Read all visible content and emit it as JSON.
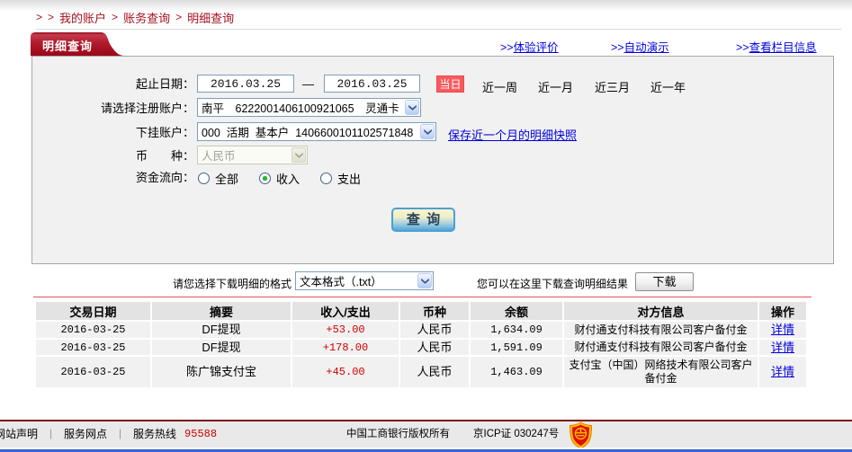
{
  "breadcrumb": {
    "prefix1": ">",
    "prefix2": ">",
    "sep": ">",
    "items": [
      "我的账户",
      "账务查询",
      "明细查询"
    ]
  },
  "tab": {
    "label": "明细查询"
  },
  "toolbar_links": [
    {
      "prefix": ">>",
      "label": "体验评价"
    },
    {
      "prefix": ">>",
      "label": "自动演示"
    },
    {
      "prefix": ">>",
      "label": "查看栏目信息"
    }
  ],
  "form": {
    "date_label": "起止日期：",
    "date_from": "2016.03.25",
    "date_separator": "—",
    "date_to": "2016.03.25",
    "today_button": "当日",
    "quick_ranges": [
      "近一周",
      "近一月",
      "近三月",
      "近一年"
    ],
    "register_account_label": "请选择注册账户：",
    "register_account_value": "南平　6222001406100921065　灵通卡",
    "sub_account_label": "下挂账户：",
    "sub_account_value": "000  活期  基本户  1406600101102571848",
    "snapshot_link": "保存近一个月的明细快照",
    "currency_label": "币　　种：",
    "currency_value": "人民币",
    "flow_label": "资金流向：",
    "flow_options": [
      {
        "label": "全部",
        "checked": false
      },
      {
        "label": "收入",
        "checked": true
      },
      {
        "label": "支出",
        "checked": false
      }
    ],
    "query_button": "查 询"
  },
  "download": {
    "format_label": "请您选择下载明细的格式",
    "format_value": "文本格式（.txt）",
    "hint": "您可以在这里下载查询明细结果",
    "button_label": "下载"
  },
  "table": {
    "headers": [
      "交易日期",
      "摘要",
      "收入/支出",
      "币种",
      "余额",
      "对方信息",
      "操作"
    ],
    "rows": [
      {
        "date": "2016-03-25",
        "summary": "DF提现",
        "amount": "+53.00",
        "currency": "人民币",
        "balance": "1,634.09",
        "counterparty": "财付通支付科技有限公司客户备付金",
        "action": "详情"
      },
      {
        "date": "2016-03-25",
        "summary": "DF提现",
        "amount": "+178.00",
        "currency": "人民币",
        "balance": "1,591.09",
        "counterparty": "财付通支付科技有限公司客户备付金",
        "action": "详情"
      },
      {
        "date": "2016-03-25",
        "summary": "陈广锦支付宝",
        "amount": "+45.00",
        "currency": "人民币",
        "balance": "1,463.09",
        "counterparty": "支付宝（中国）网络技术有限公司客户备付金",
        "action": "详情"
      }
    ]
  },
  "footer": {
    "link1": "网站声明",
    "link2": "服务网点",
    "separator": "｜",
    "hotline_label": "服务热线",
    "hotline_number": "95588",
    "copyright": "中国工商银行版权所有",
    "icp": "京ICP证 030247号",
    "badge_icon": "icp-shield-badge-icon"
  },
  "colors": {
    "brand_red": "#a6101f",
    "tab_gradient_top": "#c43b4e",
    "tab_gradient_bottom": "#9a0919",
    "link_blue": "#0101e0",
    "amount_red": "#d10000",
    "today_button_red": "#f85a5e",
    "query_button_blue": "#54aada",
    "footer_blue_strip": "#3d6fdd"
  }
}
